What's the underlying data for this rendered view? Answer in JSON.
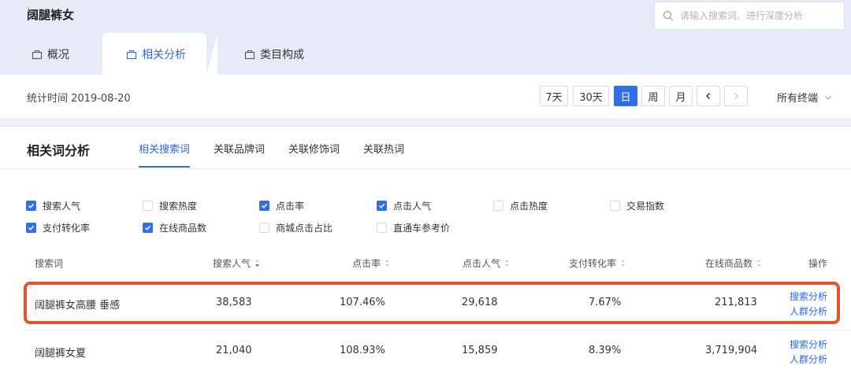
{
  "header": {
    "title": "阔腿裤女",
    "search_placeholder": "请输入搜索词、进行深度分析"
  },
  "top_tabs": [
    {
      "label": "概况",
      "active": false
    },
    {
      "label": "相关分析",
      "active": true
    },
    {
      "label": "类目构成",
      "active": false
    }
  ],
  "stat": {
    "label": "统计时间 2019-08-20",
    "buttons": [
      "7天",
      "30天",
      "日",
      "周",
      "月"
    ],
    "active_button": "日",
    "device": "所有终端"
  },
  "panel": {
    "title": "相关词分析",
    "tabs": [
      "相关搜索词",
      "关联品牌词",
      "关联修饰词",
      "关联热词"
    ],
    "active_tab": "相关搜索词"
  },
  "metrics": [
    {
      "label": "搜索人气",
      "checked": true
    },
    {
      "label": "搜索热度",
      "checked": false
    },
    {
      "label": "点击率",
      "checked": true
    },
    {
      "label": "点击人气",
      "checked": true
    },
    {
      "label": "点击热度",
      "checked": false
    },
    {
      "label": "交易指数",
      "checked": false
    },
    {
      "label": "支付转化率",
      "checked": true
    },
    {
      "label": "在线商品数",
      "checked": true
    },
    {
      "label": "商城点击占比",
      "checked": false
    },
    {
      "label": "直通车参考价",
      "checked": false
    }
  ],
  "table": {
    "headers": [
      "搜索词",
      "搜索人气",
      "点击率",
      "点击人气",
      "支付转化率",
      "在线商品数",
      "操作"
    ],
    "sorted_column": "搜索人气",
    "rows": [
      {
        "keyword": "阔腿裤女高腰 垂感",
        "search_popularity": "38,583",
        "ctr": "107.46%",
        "click_popularity": "29,618",
        "pay_conversion": "7.67%",
        "online_items": "211,813",
        "action1": "搜索分析",
        "action2": "人群分析",
        "highlighted": true
      },
      {
        "keyword": "阔腿裤女夏",
        "search_popularity": "21,040",
        "ctr": "108.93%",
        "click_popularity": "15,859",
        "pay_conversion": "8.39%",
        "online_items": "3,719,904",
        "action1": "搜索分析",
        "action2": "人群分析",
        "highlighted": false
      }
    ]
  },
  "colors": {
    "accent": "#2f6fea",
    "highlight_border": "#e2532f",
    "header_bg": "#e6ebf7"
  },
  "icons": [
    "search-icon",
    "bag-icon",
    "sort-icon",
    "chevron-left-icon",
    "chevron-right-icon",
    "chevron-down-icon",
    "check-icon"
  ]
}
